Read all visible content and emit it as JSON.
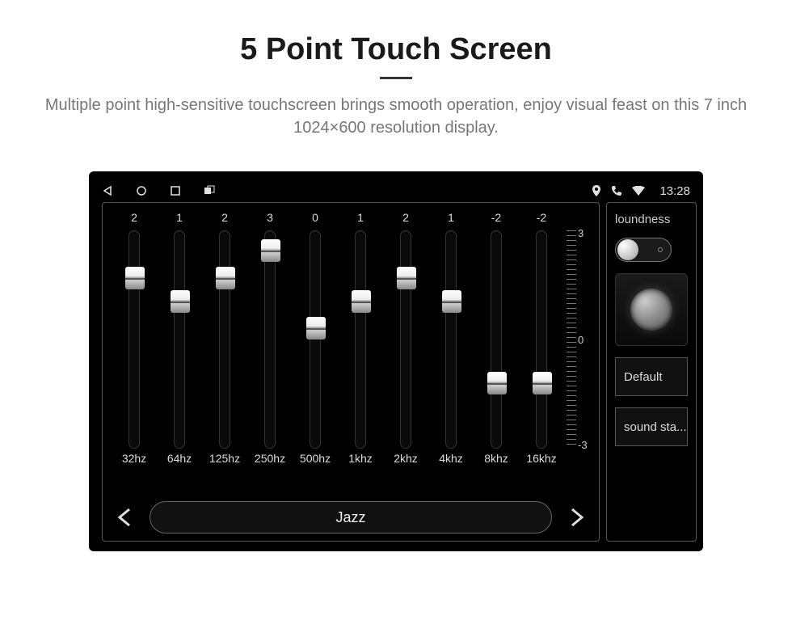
{
  "header": {
    "title": "5 Point Touch Screen",
    "subtitle": "Multiple point high-sensitive touchscreen brings smooth operation, enjoy visual feast on this 7 inch 1024×600 resolution display."
  },
  "statusbar": {
    "clock": "13:28"
  },
  "eq": {
    "bands": [
      {
        "value": "2",
        "freq": "32hz",
        "pos": 18
      },
      {
        "value": "1",
        "freq": "64hz",
        "pos": 30
      },
      {
        "value": "2",
        "freq": "125hz",
        "pos": 18
      },
      {
        "value": "3",
        "freq": "250hz",
        "pos": 4
      },
      {
        "value": "0",
        "freq": "500hz",
        "pos": 44
      },
      {
        "value": "1",
        "freq": "1khz",
        "pos": 30
      },
      {
        "value": "2",
        "freq": "2khz",
        "pos": 18
      },
      {
        "value": "1",
        "freq": "4khz",
        "pos": 30
      },
      {
        "value": "-2",
        "freq": "8khz",
        "pos": 72
      },
      {
        "value": "-2",
        "freq": "16khz",
        "pos": 72
      }
    ],
    "scale": {
      "top": "3",
      "mid": "0",
      "bot": "-3"
    },
    "preset": "Jazz"
  },
  "side": {
    "loudness_label": "loundness",
    "default_label": "Default",
    "sound_stage_label": "sound sta..."
  }
}
